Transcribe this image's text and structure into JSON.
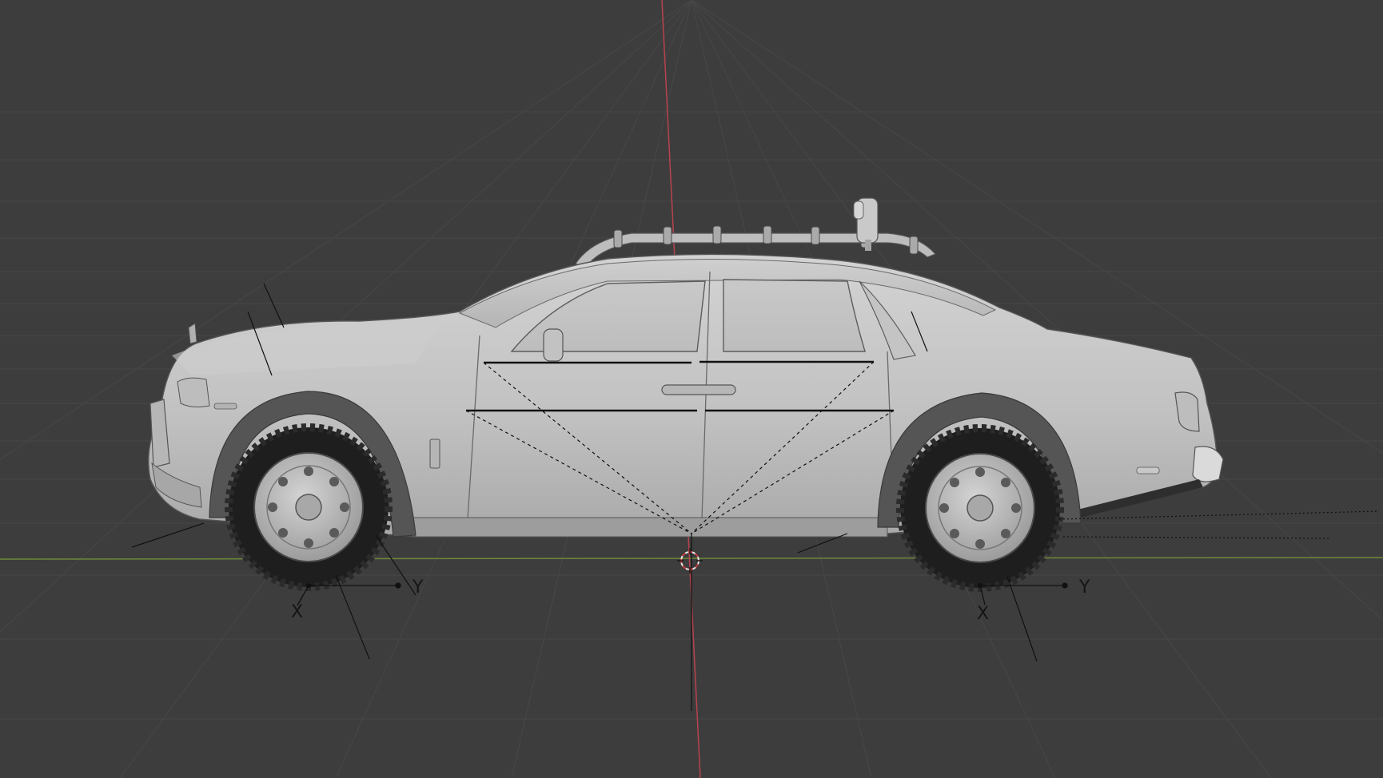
{
  "viewport": {
    "background": "#3d3d3d",
    "grid_color": "#474747",
    "x_axis_color": "#6e8a3a",
    "y_axis_color": "#b8434e",
    "shading_color": "#c8c8c8"
  },
  "scene": {
    "object": "car",
    "front_wheel_gizmo": {
      "x_label": "X",
      "y_label": "Y"
    },
    "rear_wheel_gizmo": {
      "x_label": "X",
      "y_label": "Y"
    },
    "cursor_icon": "3d-cursor-icon"
  }
}
